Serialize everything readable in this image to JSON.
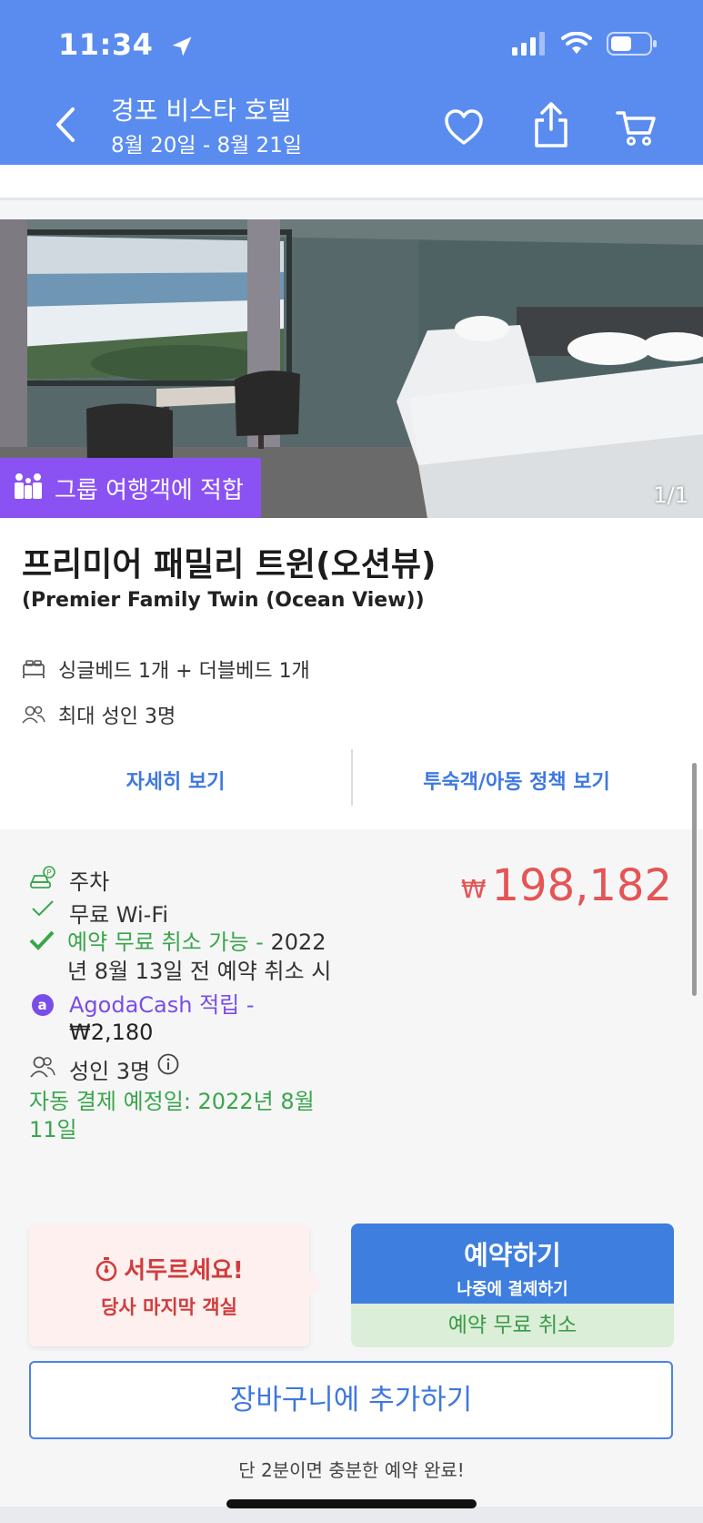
{
  "status_bar": {
    "time": "11:34"
  },
  "nav": {
    "title": "경포 비스타 호텔",
    "dates": "8월 20일 - 8월 21일"
  },
  "photo": {
    "badge": "그룹 여행객에 적합",
    "counter": "1/1"
  },
  "room": {
    "title": "프리미어 패밀리 트윈(오션뷰)",
    "subtitle": "(Premier Family Twin (Ocean View))",
    "beds": "싱글베드 1개 + 더블베드 1개",
    "capacity": "최대 성인 3명",
    "details_link": "자세히 보기",
    "policy_link": "투숙객/아동 정책 보기"
  },
  "offer": {
    "parking": "주차",
    "wifi": "무료 Wi-Fi",
    "free_cancel": "예약 무료 취소 가능",
    "free_cancel_sep": " - ",
    "free_cancel_detail": "2022년 8월 13일 전 예약 취소 시",
    "agodacash": "AgodaCash 적립 -",
    "agodacash_amount": "₩2,180",
    "adults": "성인 3명",
    "currency": "₩",
    "price": "198,182",
    "auto_pay": "자동 결제 예정일: 2022년 8월 11일",
    "hurry_title": "서두르세요!",
    "hurry_sub": "당사 마지막 객실",
    "book_label": "예약하기",
    "book_sub": "나중에 결제하기",
    "book_free_cancel": "예약 무료 취소",
    "cart_button": "장바구니에 추가하기",
    "footnote": "단 2분이면 충분한 예약 완료!"
  },
  "colors": {
    "header": "#5a8cf0",
    "price": "#e45555",
    "green": "#3aa64a",
    "purple": "#8a52f3",
    "button_blue": "#3e7ede"
  }
}
